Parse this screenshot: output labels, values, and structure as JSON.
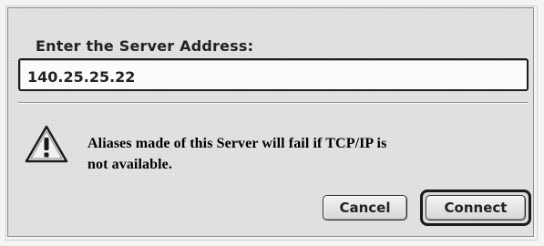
{
  "dialog": {
    "prompt_label": "Enter the Server Address:",
    "address_value": "140.25.25.22",
    "warning_line1": "Aliases made of this Server will fail if TCP/IP is",
    "warning_line2": "not available.",
    "warning_icon": "warning-triangle-icon",
    "buttons": {
      "cancel": "Cancel",
      "connect": "Connect"
    }
  }
}
